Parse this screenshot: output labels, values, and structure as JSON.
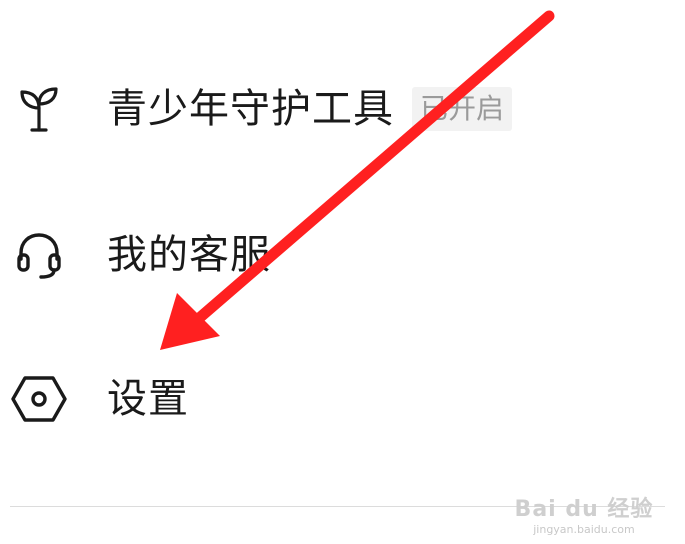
{
  "menu": {
    "items": [
      {
        "label": "青少年守护工具",
        "badge": "已开启",
        "icon": "sprout-icon"
      },
      {
        "label": "我的客服",
        "icon": "headset-icon"
      },
      {
        "label": "设置",
        "icon": "hexagon-settings-icon"
      }
    ]
  },
  "annotation": {
    "arrow_color": "#ff2020"
  },
  "watermark": {
    "logo_text": "Bai du 经验",
    "sub_text": "jingyan.baidu.com"
  },
  "colors": {
    "text": "#1a1a1a",
    "badge_bg": "#f2f2f2",
    "badge_text": "#9a9a9a",
    "divider": "#dcdcdc",
    "icon": "#1a1a1a"
  }
}
